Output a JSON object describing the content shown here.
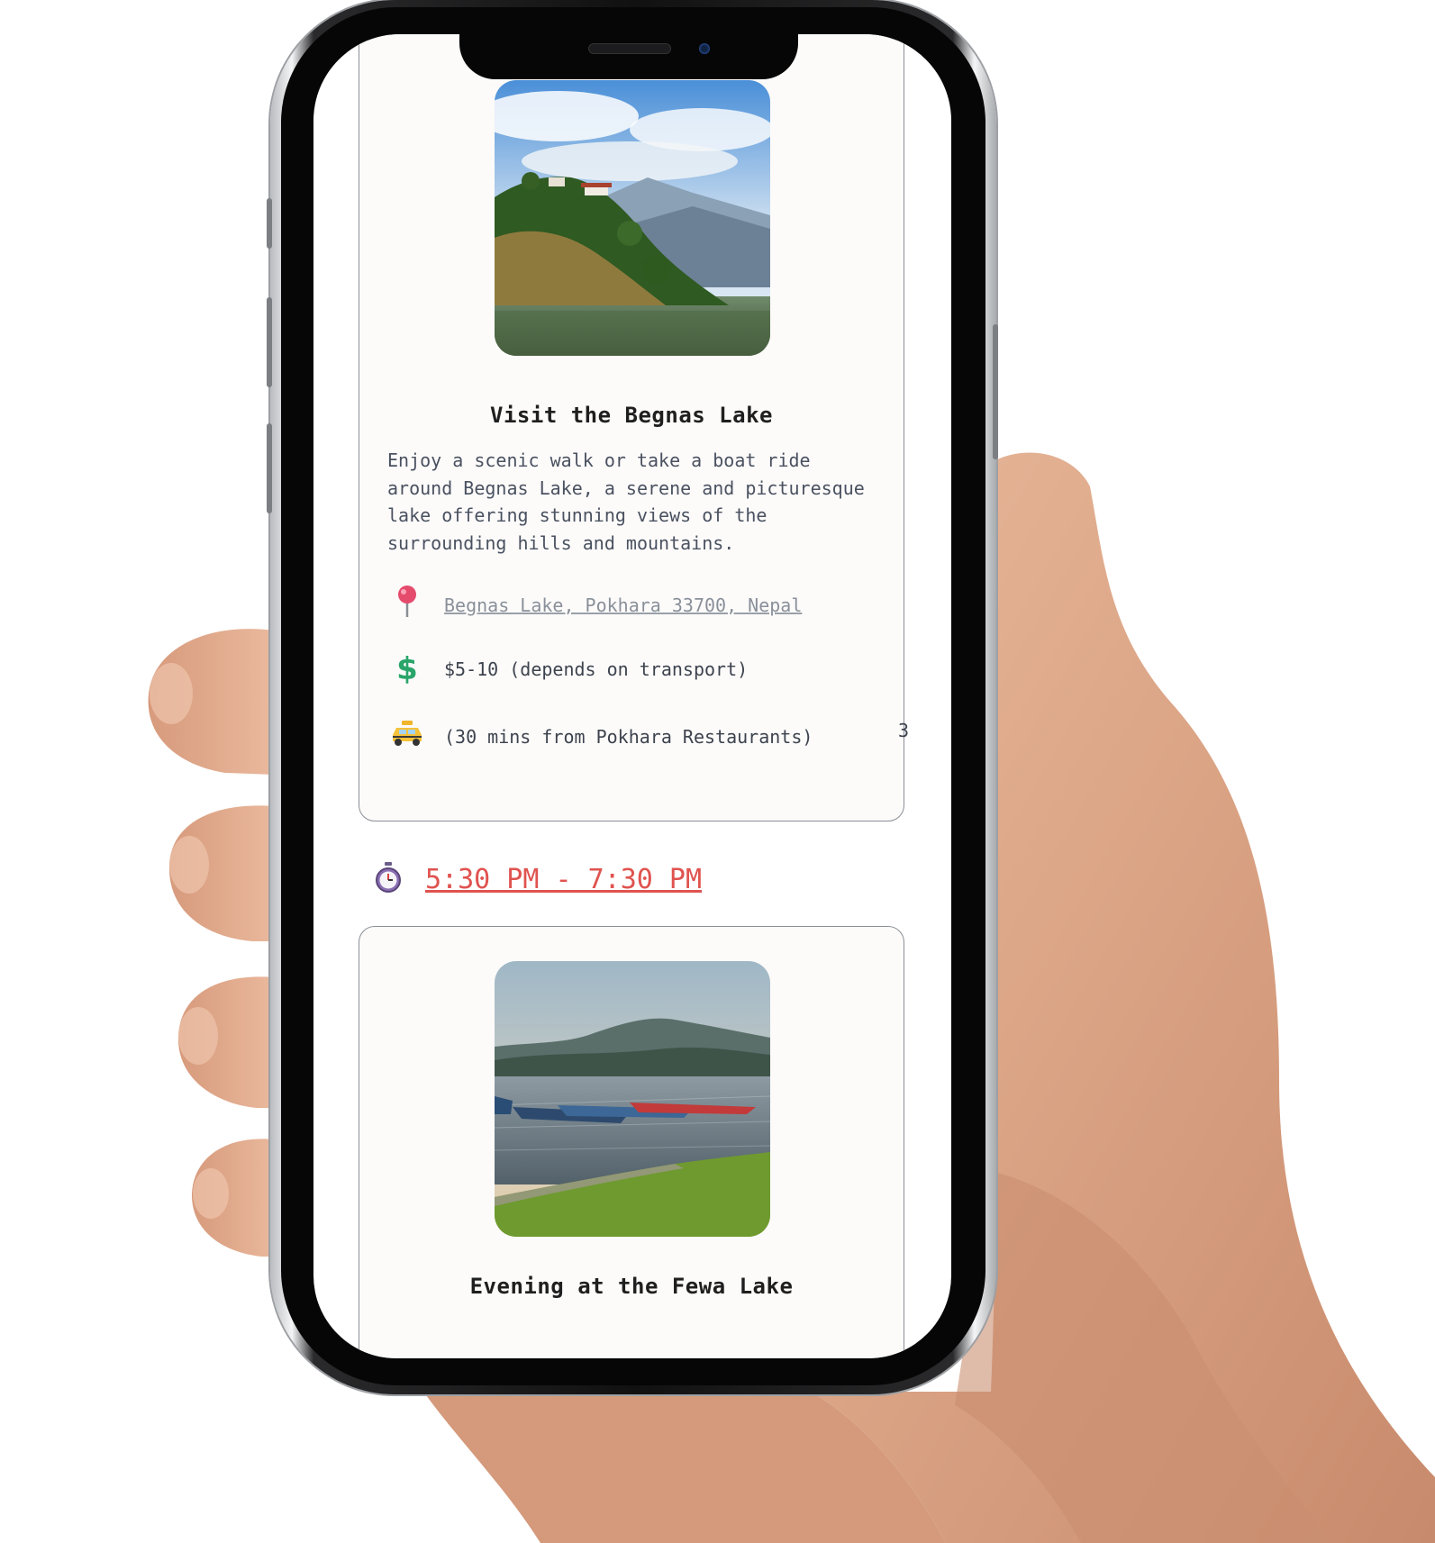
{
  "screen": {
    "activity1": {
      "title": "Visit the Begnas Lake",
      "description": "Enjoy a scenic walk or take a boat ride around Begnas Lake, a serene and picturesque lake offering stunning views of the surrounding hills and mountains.",
      "location": "Begnas Lake, Pokhara 33700, Nepal",
      "cost": "$5-10 (depends on transport)",
      "transport": "(30 mins from Pokhara Restaurants)",
      "marker": "3",
      "icons": {
        "location": "pin-icon",
        "cost": "dollar-icon",
        "transport": "taxi-icon"
      }
    },
    "time_slot": {
      "label": "5:30 PM - 7:30 PM",
      "icon": "stopwatch-icon",
      "color": "#e0534f"
    },
    "activity2": {
      "title": "Evening at the Fewa Lake"
    }
  }
}
